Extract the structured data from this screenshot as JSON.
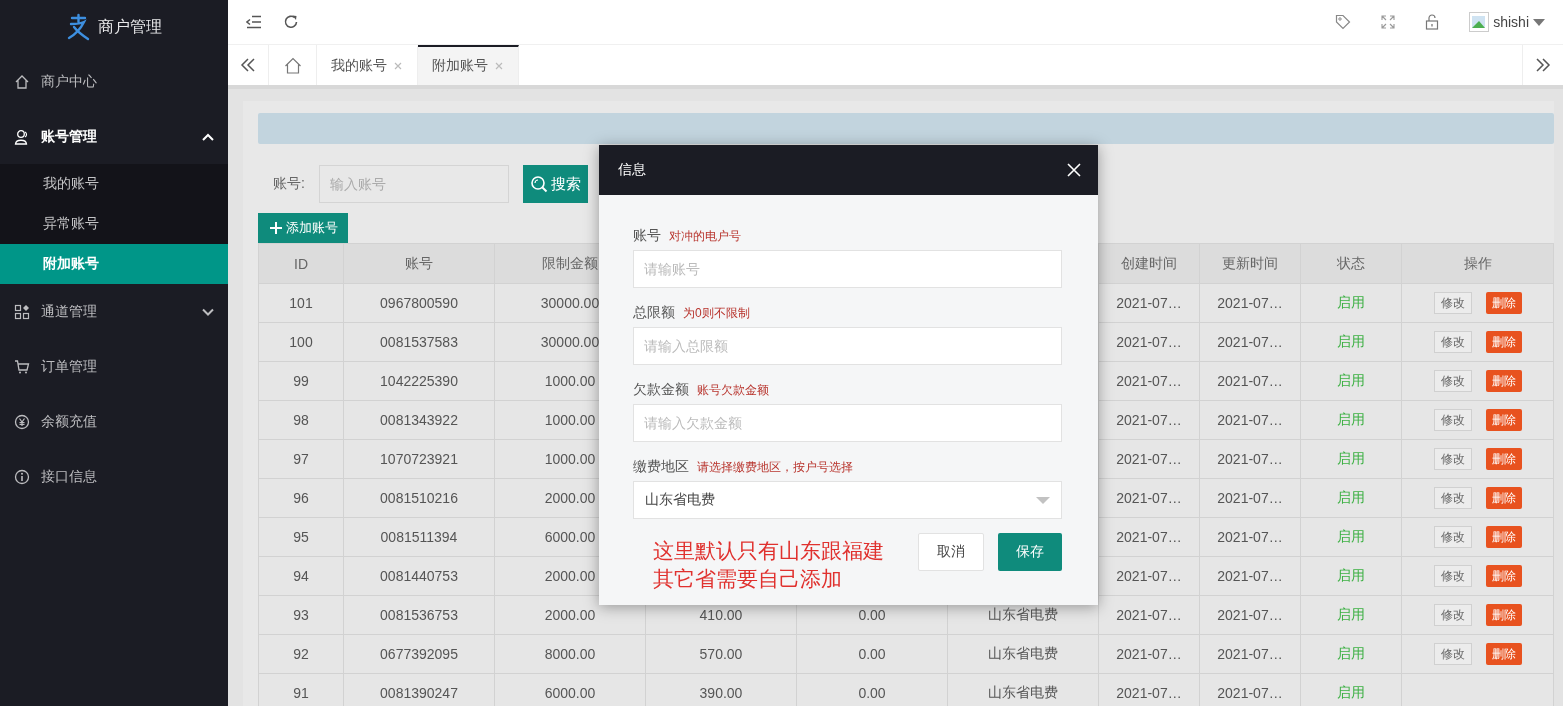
{
  "sidebar": {
    "logo": {
      "title": "商户管理"
    },
    "items": [
      {
        "label": "商户中心"
      },
      {
        "label": "账号管理",
        "expanded": true,
        "children": [
          {
            "label": "我的账号",
            "selected": false
          },
          {
            "label": "异常账号",
            "selected": false
          },
          {
            "label": "附加账号",
            "selected": true
          }
        ]
      },
      {
        "label": "通道管理",
        "expanded": false
      },
      {
        "label": "订单管理"
      },
      {
        "label": "余额充值"
      },
      {
        "label": "接口信息"
      }
    ]
  },
  "header": {
    "user": "shishi"
  },
  "tabs": [
    {
      "label": "我的账号",
      "selected": false
    },
    {
      "label": "附加账号",
      "selected": true
    }
  ],
  "search": {
    "label": "账号:",
    "placeholder": "输入账号",
    "button": "搜索"
  },
  "add_button": "添加账号",
  "table": {
    "columns": [
      "ID",
      "账号",
      "限制金额",
      null,
      null,
      null,
      "创建时间",
      "更新时间",
      "状态",
      "操作"
    ],
    "rows": [
      {
        "cells": [
          "101",
          "0967800590",
          "30000.00",
          null,
          null,
          null,
          "2021-07…",
          "2021-07…",
          "启用"
        ],
        "edit": "修改",
        "delete": "删除"
      },
      {
        "cells": [
          "100",
          "0081537583",
          "30000.00",
          null,
          null,
          null,
          "2021-07…",
          "2021-07…",
          "启用"
        ],
        "edit": "修改",
        "delete": "删除"
      },
      {
        "cells": [
          "99",
          "1042225390",
          "1000.00",
          null,
          null,
          null,
          "2021-07…",
          "2021-07…",
          "启用"
        ],
        "edit": "修改",
        "delete": "删除"
      },
      {
        "cells": [
          "98",
          "0081343922",
          "1000.00",
          null,
          null,
          null,
          "2021-07…",
          "2021-07…",
          "启用"
        ],
        "edit": "修改",
        "delete": "删除"
      },
      {
        "cells": [
          "97",
          "1070723921",
          "1000.00",
          null,
          null,
          null,
          "2021-07…",
          "2021-07…",
          "启用"
        ],
        "edit": "修改",
        "delete": "删除"
      },
      {
        "cells": [
          "96",
          "0081510216",
          "2000.00",
          null,
          null,
          null,
          "2021-07…",
          "2021-07…",
          "启用"
        ],
        "edit": "修改",
        "delete": "删除"
      },
      {
        "cells": [
          "95",
          "0081511394",
          "6000.00",
          null,
          null,
          null,
          "2021-07…",
          "2021-07…",
          "启用"
        ],
        "edit": "修改",
        "delete": "删除"
      },
      {
        "cells": [
          "94",
          "0081440753",
          "2000.00",
          null,
          null,
          null,
          "2021-07…",
          "2021-07…",
          "启用"
        ],
        "edit": "修改",
        "delete": "删除"
      },
      {
        "cells": [
          "93",
          "0081536753",
          "2000.00",
          "410.00",
          "0.00",
          "山东省电费",
          "2021-07…",
          "2021-07…",
          "启用"
        ],
        "edit": "修改",
        "delete": "删除"
      },
      {
        "cells": [
          "92",
          "0677392095",
          "8000.00",
          "570.00",
          "0.00",
          "山东省电费",
          "2021-07…",
          "2021-07…",
          "启用"
        ],
        "edit": "修改",
        "delete": "删除"
      },
      {
        "cells": [
          "91",
          "0081390247",
          "6000.00",
          "390.00",
          "0.00",
          "山东省电费",
          "2021-07…",
          "2021-07…",
          "启用"
        ]
      }
    ]
  },
  "dialog": {
    "title": "信息",
    "fields": [
      {
        "kind": "input",
        "label": "账号",
        "hint": "对冲的电户号",
        "placeholder": "请输账号"
      },
      {
        "kind": "input",
        "label": "总限额",
        "hint": "为0则不限制",
        "placeholder": "请输入总限额"
      },
      {
        "kind": "input",
        "label": "欠款金额",
        "hint": "账号欠款金额",
        "placeholder": "请输入欠款金额"
      },
      {
        "kind": "select",
        "label": "缴费地区",
        "hint": "请选择缴费地区，按户号选择",
        "value": "山东省电费"
      }
    ],
    "note_lines": [
      "这里默认只有山东跟福建",
      "其它省需要自己添加"
    ],
    "cancel": "取消",
    "save": "保存"
  }
}
